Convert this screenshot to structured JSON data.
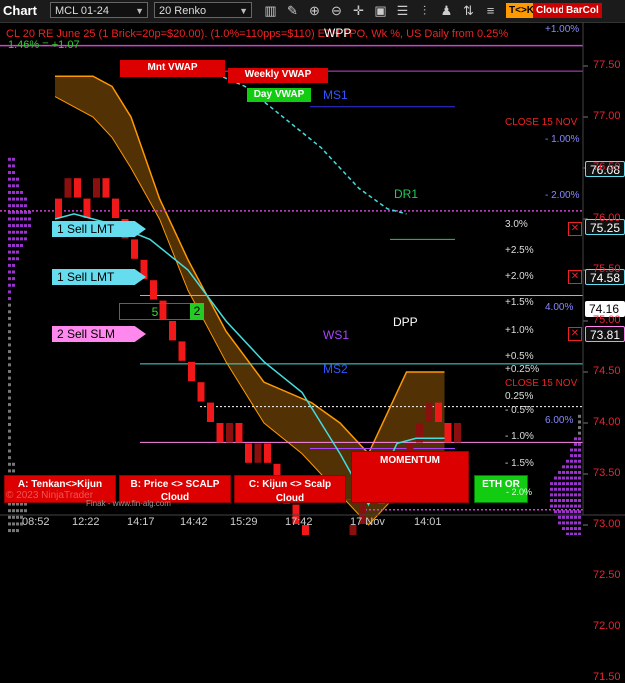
{
  "toolbar": {
    "title": "Chart",
    "instrument": "MCL 01-24",
    "interval": "20 Renko",
    "icons": [
      "bars-icon",
      "drawing-pencil-icon",
      "zoom-in-icon",
      "zoom-out-icon",
      "crosshair-icon",
      "data-box-icon",
      "properties-icon",
      "indicators-icon",
      "strategies-icon",
      "chart-trader-icon",
      "trade-lines-icon"
    ],
    "buttons": [
      "T<>K",
      "Cloud",
      "BarCol"
    ]
  },
  "header": {
    "info_line": "CL 20 RE June 25 (1 Brick=20p=$20.00). (1.0%=110pps=$110) ETH TPO, Wk %, US Daily from 0.25%",
    "pct_label": "1.46% = +1.07",
    "wpp_label": "WPP"
  },
  "levels": {
    "mnt_vwap": "Mnt VWAP",
    "weekly_vwap": "Weekly VWAP",
    "day_vwap": "Day VWAP",
    "ms1": "MS1",
    "ms2": "MS2",
    "dr1": "DR1",
    "ws1": "WS1",
    "dpp": "DPP",
    "close_label": "CLOSE 15 NOV",
    "close_label2": "CLOSE 15 NOV"
  },
  "pct_levels": [
    "+1.00%",
    "- 1.00%",
    "- 2.00%",
    "3.0%",
    "+2.5%",
    "+2.0%",
    "+1.5%",
    "4.00%",
    "+1.0%",
    "+0.5%",
    "+0.25%",
    "0.25%",
    "- 0.5%",
    "6.00%",
    "- 1.0%",
    "- 1.5%",
    "- 1.0%"
  ],
  "orders": [
    {
      "label": "1 Sell LMT",
      "price": "75.25"
    },
    {
      "label": "1 Sell LMT",
      "price": "74.58"
    },
    {
      "label": "2 Sell SLM",
      "price": "73.81"
    }
  ],
  "position": {
    "qty": "5",
    "side_qty": "2"
  },
  "price_tags": {
    "p1": "76.08",
    "p2": "74.16"
  },
  "bottom_buttons": [
    {
      "label": "A: Tenkan<>Kijun"
    },
    {
      "label": "B: Price <> SCALP Cloud"
    },
    {
      "label": "C: Kijun <> Scalp Cloud"
    },
    {
      "label": "MOMENTUM"
    },
    {
      "label": "ETH OR"
    }
  ],
  "watermark": "© 2023 NinjaTrader",
  "watermark2": "Finak - www.fin-alg.com",
  "eth_sub": "- 2.0%",
  "x_axis": [
    "08:52",
    "12:22",
    "14:17",
    "14:42",
    "15:29",
    "17:42",
    "17 Nov",
    "14:01"
  ],
  "y_axis": [
    "77.50",
    "77.00",
    "76.50",
    "76.00",
    "75.50",
    "75.00",
    "74.50",
    "74.00",
    "73.50",
    "73.00",
    "72.50",
    "72.00",
    "71.50"
  ],
  "chart_data": {
    "type": "renko",
    "brick_size": 0.2,
    "ylim": [
      71.3,
      77.7
    ],
    "bricks": [
      {
        "o": 76.2,
        "c": 76.0,
        "dir": "down"
      },
      {
        "o": 76.2,
        "c": 76.4,
        "dir": "up"
      },
      {
        "o": 76.4,
        "c": 76.2,
        "dir": "down"
      },
      {
        "o": 76.2,
        "c": 76.0,
        "dir": "down"
      },
      {
        "o": 76.2,
        "c": 76.4,
        "dir": "up"
      },
      {
        "o": 76.4,
        "c": 76.2,
        "dir": "down"
      },
      {
        "o": 76.2,
        "c": 76.0,
        "dir": "down"
      },
      {
        "o": 76.0,
        "c": 75.8,
        "dir": "down"
      },
      {
        "o": 75.8,
        "c": 75.6,
        "dir": "down"
      },
      {
        "o": 75.6,
        "c": 75.4,
        "dir": "down"
      },
      {
        "o": 75.4,
        "c": 75.2,
        "dir": "down"
      },
      {
        "o": 75.2,
        "c": 75.0,
        "dir": "down"
      },
      {
        "o": 75.0,
        "c": 74.8,
        "dir": "down"
      },
      {
        "o": 74.8,
        "c": 74.6,
        "dir": "down"
      },
      {
        "o": 74.6,
        "c": 74.4,
        "dir": "down"
      },
      {
        "o": 74.4,
        "c": 74.2,
        "dir": "down"
      },
      {
        "o": 74.2,
        "c": 74.0,
        "dir": "down"
      },
      {
        "o": 74.0,
        "c": 73.8,
        "dir": "down"
      },
      {
        "o": 73.8,
        "c": 74.0,
        "dir": "up"
      },
      {
        "o": 74.0,
        "c": 73.8,
        "dir": "down"
      },
      {
        "o": 73.8,
        "c": 73.6,
        "dir": "down"
      },
      {
        "o": 73.6,
        "c": 73.8,
        "dir": "up"
      },
      {
        "o": 73.8,
        "c": 73.6,
        "dir": "down"
      },
      {
        "o": 73.6,
        "c": 73.4,
        "dir": "down"
      },
      {
        "o": 73.4,
        "c": 73.2,
        "dir": "down"
      },
      {
        "o": 73.2,
        "c": 73.0,
        "dir": "down"
      },
      {
        "o": 73.0,
        "c": 72.8,
        "dir": "down"
      },
      {
        "o": 72.8,
        "c": 72.6,
        "dir": "down"
      },
      {
        "o": 72.6,
        "c": 72.4,
        "dir": "down"
      },
      {
        "o": 72.4,
        "c": 72.6,
        "dir": "up"
      },
      {
        "o": 72.6,
        "c": 72.8,
        "dir": "up"
      },
      {
        "o": 72.8,
        "c": 73.0,
        "dir": "up"
      },
      {
        "o": 73.0,
        "c": 73.2,
        "dir": "up"
      },
      {
        "o": 73.2,
        "c": 73.4,
        "dir": "up"
      },
      {
        "o": 73.4,
        "c": 73.2,
        "dir": "down"
      },
      {
        "o": 73.2,
        "c": 73.4,
        "dir": "up"
      },
      {
        "o": 73.4,
        "c": 73.6,
        "dir": "up"
      },
      {
        "o": 73.6,
        "c": 73.8,
        "dir": "up"
      },
      {
        "o": 73.8,
        "c": 74.0,
        "dir": "up"
      },
      {
        "o": 74.0,
        "c": 74.2,
        "dir": "up"
      },
      {
        "o": 74.2,
        "c": 74.0,
        "dir": "down"
      },
      {
        "o": 74.0,
        "c": 73.8,
        "dir": "down"
      },
      {
        "o": 73.8,
        "c": 74.0,
        "dir": "up"
      }
    ],
    "lines": {
      "tenkan_cyan": [
        [
          0,
          76.0
        ],
        [
          2,
          76.05
        ],
        [
          4,
          76.0
        ],
        [
          6,
          75.95
        ],
        [
          10,
          75.8
        ],
        [
          14,
          75.5
        ],
        [
          18,
          75.0
        ],
        [
          22,
          74.6
        ],
        [
          26,
          74.3
        ],
        [
          30,
          73.7
        ],
        [
          33,
          73.2
        ],
        [
          35,
          73.6
        ],
        [
          36,
          73.8
        ],
        [
          38,
          73.85
        ],
        [
          41,
          73.85
        ]
      ],
      "cloud_orange_upper": [
        [
          0,
          77.4
        ],
        [
          4,
          77.4
        ],
        [
          6,
          77.3
        ],
        [
          8,
          77.0
        ],
        [
          11,
          76.2
        ],
        [
          14,
          75.6
        ],
        [
          18,
          74.9
        ],
        [
          22,
          74.4
        ],
        [
          27,
          74.2
        ],
        [
          30,
          74.0
        ],
        [
          33,
          73.7
        ],
        [
          37,
          74.5
        ],
        [
          41,
          74.5
        ]
      ],
      "cloud_orange_lower": [
        [
          0,
          77.2
        ],
        [
          4,
          77.0
        ],
        [
          6,
          76.8
        ],
        [
          8,
          76.5
        ],
        [
          11,
          76.0
        ],
        [
          14,
          75.3
        ],
        [
          18,
          74.6
        ],
        [
          22,
          74.0
        ],
        [
          26,
          73.7
        ],
        [
          30,
          73.3
        ],
        [
          33,
          73.0
        ],
        [
          36,
          73.3
        ],
        [
          41,
          73.5
        ]
      ],
      "vwap_cyan_dashed": [
        [
          15,
          77.5
        ],
        [
          20,
          77.3
        ],
        [
          24,
          77.0
        ],
        [
          28,
          76.7
        ],
        [
          32,
          76.3
        ],
        [
          35,
          76.1
        ],
        [
          37,
          76.05
        ]
      ]
    },
    "levels": {
      "wpp": 77.95,
      "mnt_vwap": 77.45,
      "weekly_vwap": 77.3,
      "day_vwap": 77.05,
      "ms1": 77.1,
      "close_15_nov": 76.08,
      "dr1": 75.8,
      "order1": 75.25,
      "order2": 74.58,
      "price_last": 74.16,
      "order3": 73.81,
      "ms2": 73.25,
      "close_magenta": 73.15
    }
  }
}
